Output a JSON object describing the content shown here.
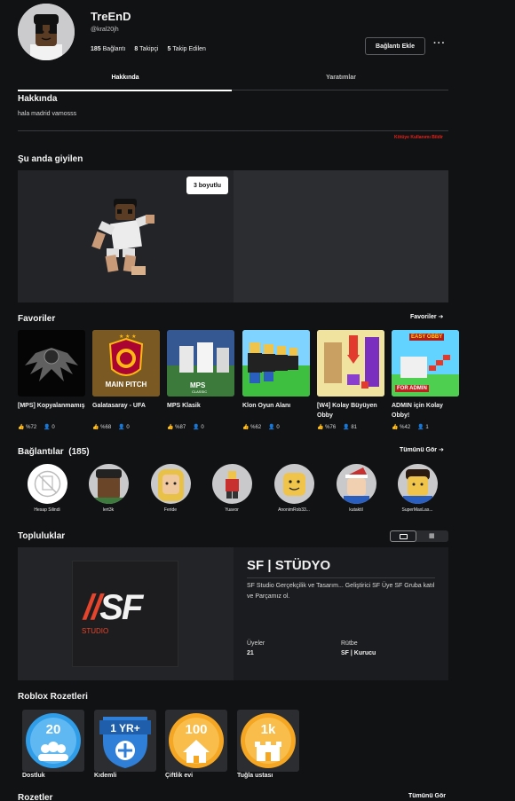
{
  "profile": {
    "display_name": "TreEnD",
    "username": "@kral20jh",
    "stats": [
      {
        "count": "185",
        "label": "Bağlantı"
      },
      {
        "count": "8",
        "label": "Takipçi"
      },
      {
        "count": "5",
        "label": "Takip Edilen"
      }
    ],
    "add_connection_label": "Bağlantı Ekle",
    "more_label": "···"
  },
  "tabs": {
    "about": "Hakkında",
    "creations": "Yaratımlar"
  },
  "about": {
    "title": "Hakkında",
    "body": "hala madrid vamosss",
    "report": "Kötüye Kullanımı Bildir"
  },
  "wearing": {
    "title": "Şu anda giyilen",
    "button_3d": "3 boyutlu"
  },
  "favorites": {
    "title": "Favoriler",
    "see_all": "Favoriler",
    "items": [
      {
        "name": "[MPS] Kopyalanmamış",
        "rating": "%72",
        "players": "0"
      },
      {
        "name": "Galatasaray - UFA",
        "rating": "%68",
        "players": "0"
      },
      {
        "name": "MPS Klasik",
        "rating": "%87",
        "players": "0"
      },
      {
        "name": "Klon Oyun Alanı",
        "rating": "%62",
        "players": "0"
      },
      {
        "name": "[W4] Kolay Büyüyen Obby",
        "rating": "%76",
        "players": "81"
      },
      {
        "name": "ADMIN için Kolay Obby!",
        "rating": "%42",
        "players": "1"
      }
    ],
    "thumb_texts": {
      "main_pitch": "MAIN PITCH",
      "mps": "MPS",
      "mps_sub": "CLASSIC",
      "easy_obby": "EASY OBBY",
      "for_admin": "FOR ADMIN"
    }
  },
  "connections": {
    "title": "Bağlantılar",
    "count": "(185)",
    "see_all": "Tümünü Gör",
    "items": [
      {
        "name": "Hesap Silindi"
      },
      {
        "name": "lert3k"
      },
      {
        "name": "Feride"
      },
      {
        "name": "Yuavor"
      },
      {
        "name": "AnonimRob33..."
      },
      {
        "name": "kutaktil"
      },
      {
        "name": "SuperMaxLas..."
      }
    ]
  },
  "communities": {
    "title": "Topluluklar",
    "name": "SF | STÜDYO",
    "description": "SF Studio Gerçekçilik ve Tasarım... Geliştirici SF Üye SF Gruba katıl ve Parçamız ol.",
    "members_label": "Üyeler",
    "members_value": "21",
    "rank_label": "Rütbe",
    "rank_value": "SF | Kurucu",
    "logo_text": "//SF",
    "logo_sub": "STUDIO"
  },
  "roblox_badges": {
    "title": "Roblox Rozetleri",
    "items": [
      {
        "name": "Dostluk",
        "num": "20"
      },
      {
        "name": "Kıdemli",
        "num": "1 YR+"
      },
      {
        "name": "Çiftlik evi",
        "num": "100"
      },
      {
        "name": "Tuğla ustası",
        "num": "1k"
      }
    ]
  },
  "badges": {
    "title": "Rozetler",
    "see_all": "Tümünü Gör"
  },
  "colors": {
    "background": "#111214",
    "panel": "#232427",
    "report": "#e2231a",
    "galatasaray": "#a90432",
    "galatasaray_gold": "#fdb912"
  }
}
